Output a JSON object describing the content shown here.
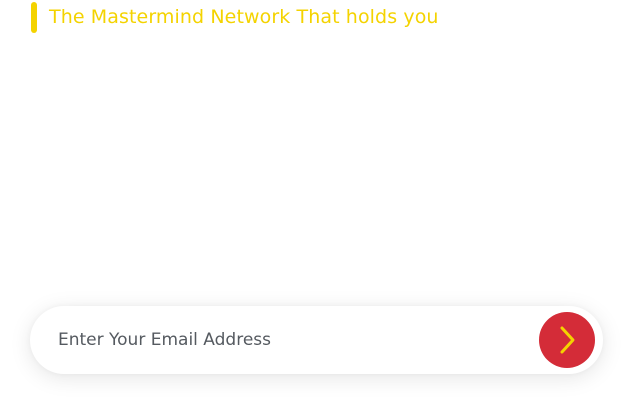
{
  "header": {
    "tagline": "The Mastermind Network That holds you"
  },
  "signup": {
    "email_placeholder": "Enter Your Email Address",
    "submit_icon": "chevron-right-icon"
  },
  "colors": {
    "accent": "#f4d300",
    "button": "#d42c38",
    "placeholder": "#555a60"
  }
}
